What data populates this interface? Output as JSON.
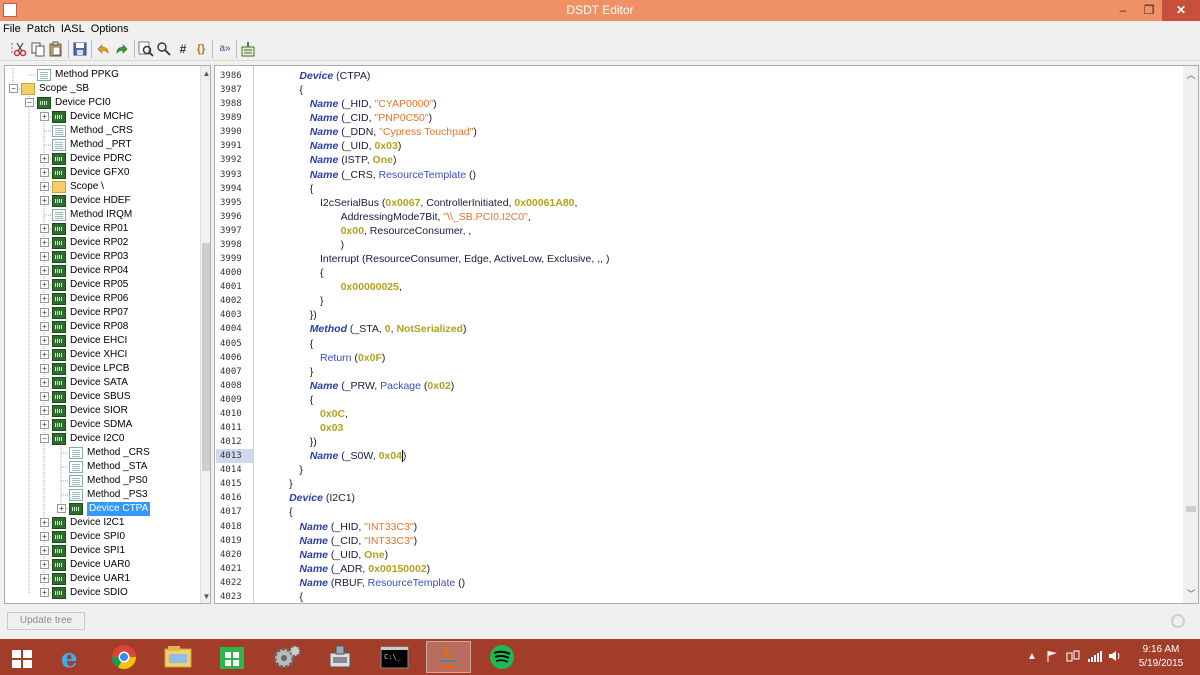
{
  "window": {
    "title": "DSDT Editor",
    "min_glyph": "–",
    "max_glyph": "❐",
    "close_glyph": "✕"
  },
  "menu": [
    "File",
    "Patch",
    "IASL",
    "Options"
  ],
  "toolbar_icons": [
    "cut-icon",
    "copy-icon",
    "paste-icon",
    "save-icon",
    "undo-icon",
    "redo-icon",
    "find-icon",
    "find-replace-icon",
    "hash-icon",
    "braces-icon",
    "text-icon",
    "compile-icon"
  ],
  "tree": [
    {
      "label": "Method PPKG",
      "level": 1,
      "icon": "method",
      "expander": ""
    },
    {
      "label": "Scope _SB",
      "level": 0,
      "icon": "scope",
      "expander": "−"
    },
    {
      "label": "Device PCI0",
      "level": 1,
      "icon": "device",
      "expander": "−"
    },
    {
      "label": "Device MCHC",
      "level": 2,
      "icon": "device",
      "expander": "+"
    },
    {
      "label": "Method _CRS",
      "level": 2,
      "icon": "method",
      "expander": ""
    },
    {
      "label": "Method _PRT",
      "level": 2,
      "icon": "method",
      "expander": ""
    },
    {
      "label": "Device PDRC",
      "level": 2,
      "icon": "device",
      "expander": "+"
    },
    {
      "label": "Device GFX0",
      "level": 2,
      "icon": "device",
      "expander": "+"
    },
    {
      "label": "Scope \\",
      "level": 2,
      "icon": "scope",
      "expander": "+"
    },
    {
      "label": "Device HDEF",
      "level": 2,
      "icon": "device",
      "expander": "+"
    },
    {
      "label": "Method IRQM",
      "level": 2,
      "icon": "method",
      "expander": ""
    },
    {
      "label": "Device RP01",
      "level": 2,
      "icon": "device",
      "expander": "+"
    },
    {
      "label": "Device RP02",
      "level": 2,
      "icon": "device",
      "expander": "+"
    },
    {
      "label": "Device RP03",
      "level": 2,
      "icon": "device",
      "expander": "+"
    },
    {
      "label": "Device RP04",
      "level": 2,
      "icon": "device",
      "expander": "+"
    },
    {
      "label": "Device RP05",
      "level": 2,
      "icon": "device",
      "expander": "+"
    },
    {
      "label": "Device RP06",
      "level": 2,
      "icon": "device",
      "expander": "+"
    },
    {
      "label": "Device RP07",
      "level": 2,
      "icon": "device",
      "expander": "+"
    },
    {
      "label": "Device RP08",
      "level": 2,
      "icon": "device",
      "expander": "+"
    },
    {
      "label": "Device EHCI",
      "level": 2,
      "icon": "device",
      "expander": "+"
    },
    {
      "label": "Device XHCI",
      "level": 2,
      "icon": "device",
      "expander": "+"
    },
    {
      "label": "Device LPCB",
      "level": 2,
      "icon": "device",
      "expander": "+"
    },
    {
      "label": "Device SATA",
      "level": 2,
      "icon": "device",
      "expander": "+"
    },
    {
      "label": "Device SBUS",
      "level": 2,
      "icon": "device",
      "expander": "+"
    },
    {
      "label": "Device SIOR",
      "level": 2,
      "icon": "device",
      "expander": "+"
    },
    {
      "label": "Device SDMA",
      "level": 2,
      "icon": "device",
      "expander": "+"
    },
    {
      "label": "Device I2C0",
      "level": 2,
      "icon": "device",
      "expander": "−"
    },
    {
      "label": "Method _CRS",
      "level": 3,
      "icon": "method",
      "expander": ""
    },
    {
      "label": "Method _STA",
      "level": 3,
      "icon": "method",
      "expander": ""
    },
    {
      "label": "Method _PS0",
      "level": 3,
      "icon": "method",
      "expander": ""
    },
    {
      "label": "Method _PS3",
      "level": 3,
      "icon": "method",
      "expander": ""
    },
    {
      "label": "Device CTPA",
      "level": 3,
      "icon": "device",
      "expander": "+",
      "selected": true
    },
    {
      "label": "Device I2C1",
      "level": 2,
      "icon": "device",
      "expander": "+"
    },
    {
      "label": "Device SPI0",
      "level": 2,
      "icon": "device",
      "expander": "+"
    },
    {
      "label": "Device SPI1",
      "level": 2,
      "icon": "device",
      "expander": "+"
    },
    {
      "label": "Device UAR0",
      "level": 2,
      "icon": "device",
      "expander": "+"
    },
    {
      "label": "Device UAR1",
      "level": 2,
      "icon": "device",
      "expander": "+"
    },
    {
      "label": "Device SDIO",
      "level": 2,
      "icon": "device",
      "expander": "+"
    }
  ],
  "editor": {
    "current_line": "4013",
    "lines": [
      {
        "n": "3986",
        "indent": 8,
        "t": [
          [
            "kw",
            "Device"
          ],
          [
            "p",
            " (CTPA)"
          ]
        ]
      },
      {
        "n": "3987",
        "indent": 8,
        "t": [
          [
            "p",
            "{"
          ]
        ]
      },
      {
        "n": "3988",
        "indent": 9,
        "t": [
          [
            "kw",
            "Name"
          ],
          [
            "p",
            " (_HID, "
          ],
          [
            "str",
            "\"CYAP0000\""
          ],
          [
            "p",
            ")"
          ]
        ]
      },
      {
        "n": "3989",
        "indent": 9,
        "t": [
          [
            "kw",
            "Name"
          ],
          [
            "p",
            " (_CID, "
          ],
          [
            "str",
            "\"PNP0C50\""
          ],
          [
            "p",
            ")"
          ]
        ]
      },
      {
        "n": "3990",
        "indent": 9,
        "t": [
          [
            "kw",
            "Name"
          ],
          [
            "p",
            " (_DDN, "
          ],
          [
            "str",
            "\"Cypress Touchpad\""
          ],
          [
            "p",
            ")"
          ]
        ]
      },
      {
        "n": "3991",
        "indent": 9,
        "t": [
          [
            "kw",
            "Name"
          ],
          [
            "p",
            " (_UID, "
          ],
          [
            "num",
            "0x03"
          ],
          [
            "p",
            ")"
          ]
        ]
      },
      {
        "n": "3992",
        "indent": 9,
        "t": [
          [
            "kw",
            "Name"
          ],
          [
            "p",
            " (ISTP, "
          ],
          [
            "num",
            "One"
          ],
          [
            "p",
            ")"
          ]
        ]
      },
      {
        "n": "3993",
        "indent": 9,
        "t": [
          [
            "kw",
            "Name"
          ],
          [
            "p",
            " (_CRS, "
          ],
          [
            "res",
            "ResourceTemplate"
          ],
          [
            "p",
            " ()"
          ]
        ]
      },
      {
        "n": "3994",
        "indent": 9,
        "t": [
          [
            "p",
            "{"
          ]
        ]
      },
      {
        "n": "3995",
        "indent": 10,
        "t": [
          [
            "p",
            "I2cSerialBus ("
          ],
          [
            "num",
            "0x0067"
          ],
          [
            "p",
            ", ControllerInitiated, "
          ],
          [
            "num",
            "0x00061A80"
          ],
          [
            "p",
            ","
          ]
        ]
      },
      {
        "n": "3996",
        "indent": 12,
        "t": [
          [
            "p",
            "AddressingMode7Bit, "
          ],
          [
            "str",
            "\"\\\\_SB.PCI0.I2C0\""
          ],
          [
            "p",
            ","
          ]
        ]
      },
      {
        "n": "3997",
        "indent": 12,
        "t": [
          [
            "num",
            "0x00"
          ],
          [
            "p",
            ", ResourceConsumer, ,"
          ]
        ]
      },
      {
        "n": "3998",
        "indent": 12,
        "t": [
          [
            "p",
            ")"
          ]
        ]
      },
      {
        "n": "3999",
        "indent": 10,
        "t": [
          [
            "p",
            "Interrupt (ResourceConsumer, Edge, ActiveLow, Exclusive, ,, )"
          ]
        ]
      },
      {
        "n": "4000",
        "indent": 10,
        "t": [
          [
            "p",
            "{"
          ]
        ]
      },
      {
        "n": "4001",
        "indent": 12,
        "t": [
          [
            "num",
            "0x00000025"
          ],
          [
            "p",
            ","
          ]
        ]
      },
      {
        "n": "4002",
        "indent": 10,
        "t": [
          [
            "p",
            "}"
          ]
        ]
      },
      {
        "n": "4003",
        "indent": 9,
        "t": [
          [
            "p",
            "})"
          ]
        ]
      },
      {
        "n": "4004",
        "indent": 9,
        "t": [
          [
            "kw",
            "Method"
          ],
          [
            "p",
            " (_STA, "
          ],
          [
            "num",
            "0"
          ],
          [
            "p",
            ", "
          ],
          [
            "num",
            "NotSerialized"
          ],
          [
            "p",
            ")"
          ]
        ]
      },
      {
        "n": "4005",
        "indent": 9,
        "t": [
          [
            "p",
            "{"
          ]
        ]
      },
      {
        "n": "4006",
        "indent": 10,
        "t": [
          [
            "res",
            "Return"
          ],
          [
            "p",
            " ("
          ],
          [
            "num",
            "0x0F"
          ],
          [
            "p",
            ")"
          ]
        ]
      },
      {
        "n": "4007",
        "indent": 9,
        "t": [
          [
            "p",
            "}"
          ]
        ]
      },
      {
        "n": "4008",
        "indent": 9,
        "t": [
          [
            "kw",
            "Name"
          ],
          [
            "p",
            " (_PRW, "
          ],
          [
            "res",
            "Package"
          ],
          [
            "p",
            " ("
          ],
          [
            "num",
            "0x02"
          ],
          [
            "p",
            ")"
          ]
        ]
      },
      {
        "n": "4009",
        "indent": 9,
        "t": [
          [
            "p",
            "{"
          ]
        ]
      },
      {
        "n": "4010",
        "indent": 10,
        "t": [
          [
            "num",
            "0x0C"
          ],
          [
            "p",
            ","
          ]
        ]
      },
      {
        "n": "4011",
        "indent": 10,
        "t": [
          [
            "num",
            "0x03"
          ]
        ]
      },
      {
        "n": "4012",
        "indent": 9,
        "t": [
          [
            "p",
            "})"
          ]
        ]
      },
      {
        "n": "4013",
        "indent": 9,
        "t": [
          [
            "kw",
            "Name"
          ],
          [
            "p",
            " (_S0W, "
          ],
          [
            "num",
            "0x04"
          ],
          [
            "p",
            ")"
          ]
        ],
        "caret": true
      },
      {
        "n": "4014",
        "indent": 8,
        "t": [
          [
            "p",
            "}"
          ]
        ]
      },
      {
        "n": "4015",
        "indent": 7,
        "t": [
          [
            "p",
            "}"
          ]
        ]
      },
      {
        "n": "4016",
        "indent": 7,
        "t": [
          [
            "kw",
            "Device"
          ],
          [
            "p",
            " (I2C1)"
          ]
        ]
      },
      {
        "n": "4017",
        "indent": 7,
        "t": [
          [
            "p",
            "{"
          ]
        ]
      },
      {
        "n": "4018",
        "indent": 8,
        "t": [
          [
            "kw",
            "Name"
          ],
          [
            "p",
            " (_HID, "
          ],
          [
            "str",
            "\"INT33C3\""
          ],
          [
            "p",
            ")"
          ]
        ]
      },
      {
        "n": "4019",
        "indent": 8,
        "t": [
          [
            "kw",
            "Name"
          ],
          [
            "p",
            " (_CID, "
          ],
          [
            "str",
            "\"INT33C3\""
          ],
          [
            "p",
            ")"
          ]
        ]
      },
      {
        "n": "4020",
        "indent": 8,
        "t": [
          [
            "kw",
            "Name"
          ],
          [
            "p",
            " (_UID, "
          ],
          [
            "num",
            "One"
          ],
          [
            "p",
            ")"
          ]
        ]
      },
      {
        "n": "4021",
        "indent": 8,
        "t": [
          [
            "kw",
            "Name"
          ],
          [
            "p",
            " (_ADR, "
          ],
          [
            "num",
            "0x00150002"
          ],
          [
            "p",
            ")"
          ]
        ]
      },
      {
        "n": "4022",
        "indent": 8,
        "t": [
          [
            "kw",
            "Name"
          ],
          [
            "p",
            " (RBUF, "
          ],
          [
            "res",
            "ResourceTemplate"
          ],
          [
            "p",
            " ()"
          ]
        ]
      },
      {
        "n": "4023",
        "indent": 8,
        "t": [
          [
            "p",
            "{"
          ]
        ]
      }
    ]
  },
  "bottom": {
    "update_tree_label": "Update tree"
  },
  "taskbar": {
    "apps": [
      "start-button",
      "ie-icon",
      "chrome-icon",
      "file-explorer-icon",
      "store-icon",
      "settings-icon",
      "device-manager-icon",
      "command-prompt-icon",
      "java-icon",
      "spotify-icon"
    ],
    "clock_time": "9:16 AM",
    "clock_date": "5/19/2015"
  },
  "colors": {
    "titlebar": "#ee9266",
    "taskbar": "#a13d28",
    "selection": "#3399ff",
    "keyword": "#2b3fa8",
    "string": "#e8732a",
    "number": "#b3a21e"
  }
}
